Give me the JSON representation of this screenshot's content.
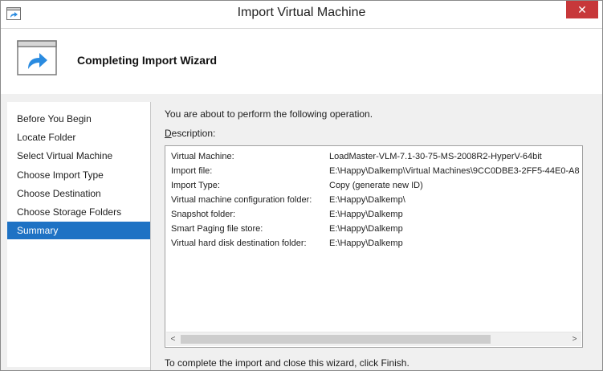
{
  "window": {
    "title": "Import Virtual Machine",
    "close_label": "✕"
  },
  "banner": {
    "title": "Completing Import Wizard"
  },
  "nav": {
    "items": [
      {
        "label": "Before You Begin"
      },
      {
        "label": "Locate Folder"
      },
      {
        "label": "Select Virtual Machine"
      },
      {
        "label": "Choose Import Type"
      },
      {
        "label": "Choose Destination"
      },
      {
        "label": "Choose Storage Folders"
      },
      {
        "label": "Summary",
        "selected": true
      }
    ]
  },
  "content": {
    "intro": "You are about to perform the following operation.",
    "description_label_accel": "D",
    "description_label_rest": "escription:",
    "rows": [
      {
        "key": "Virtual Machine:",
        "value": "LoadMaster-VLM-7.1-30-75-MS-2008R2-HyperV-64bit"
      },
      {
        "key": "Import file:",
        "value": "E:\\Happy\\Dalkemp\\Virtual Machines\\9CC0DBE3-2FF5-44E0-A8"
      },
      {
        "key": "Import Type:",
        "value": "Copy (generate new ID)"
      },
      {
        "key": "Virtual machine configuration folder:",
        "value": "E:\\Happy\\Dalkemp\\"
      },
      {
        "key": "Snapshot folder:",
        "value": "E:\\Happy\\Dalkemp"
      },
      {
        "key": "Smart Paging file store:",
        "value": "E:\\Happy\\Dalkemp"
      },
      {
        "key": "Virtual hard disk destination folder:",
        "value": "E:\\Happy\\Dalkemp"
      }
    ],
    "finish_note": "To complete the import and close this wizard, click Finish."
  },
  "scroll": {
    "left_arrow": "<",
    "right_arrow": ">"
  },
  "colors": {
    "selected_nav": "#1e72c4",
    "close_button": "#c7383a",
    "icon_arrow": "#2a8be0"
  }
}
